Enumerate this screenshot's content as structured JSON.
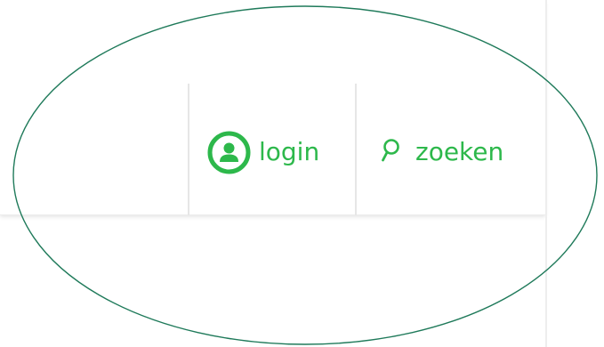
{
  "nav": {
    "login": {
      "label": "login",
      "icon": "user-circle-icon"
    },
    "search": {
      "label": "zoeken",
      "icon": "search-icon"
    }
  },
  "colors": {
    "accent": "#2db84b",
    "highlight_ellipse": "#1f7a5a",
    "divider": "#e6e6e6"
  }
}
